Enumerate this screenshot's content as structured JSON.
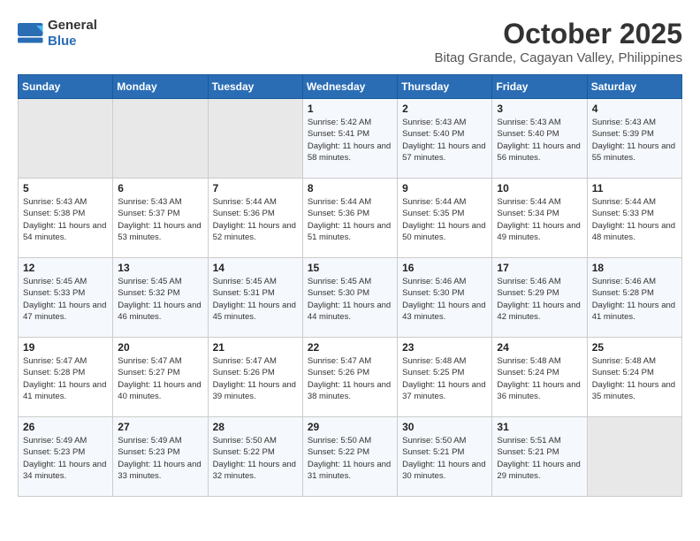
{
  "logo": {
    "general": "General",
    "blue": "Blue"
  },
  "title": "October 2025",
  "location": "Bitag Grande, Cagayan Valley, Philippines",
  "days_header": [
    "Sunday",
    "Monday",
    "Tuesday",
    "Wednesday",
    "Thursday",
    "Friday",
    "Saturday"
  ],
  "weeks": [
    [
      {
        "day": "",
        "empty": true
      },
      {
        "day": "",
        "empty": true
      },
      {
        "day": "",
        "empty": true
      },
      {
        "day": "1",
        "sunrise": "5:42 AM",
        "sunset": "5:41 PM",
        "daylight": "11 hours and 58 minutes."
      },
      {
        "day": "2",
        "sunrise": "5:43 AM",
        "sunset": "5:40 PM",
        "daylight": "11 hours and 57 minutes."
      },
      {
        "day": "3",
        "sunrise": "5:43 AM",
        "sunset": "5:40 PM",
        "daylight": "11 hours and 56 minutes."
      },
      {
        "day": "4",
        "sunrise": "5:43 AM",
        "sunset": "5:39 PM",
        "daylight": "11 hours and 55 minutes."
      }
    ],
    [
      {
        "day": "5",
        "sunrise": "5:43 AM",
        "sunset": "5:38 PM",
        "daylight": "11 hours and 54 minutes."
      },
      {
        "day": "6",
        "sunrise": "5:43 AM",
        "sunset": "5:37 PM",
        "daylight": "11 hours and 53 minutes."
      },
      {
        "day": "7",
        "sunrise": "5:44 AM",
        "sunset": "5:36 PM",
        "daylight": "11 hours and 52 minutes."
      },
      {
        "day": "8",
        "sunrise": "5:44 AM",
        "sunset": "5:36 PM",
        "daylight": "11 hours and 51 minutes."
      },
      {
        "day": "9",
        "sunrise": "5:44 AM",
        "sunset": "5:35 PM",
        "daylight": "11 hours and 50 minutes."
      },
      {
        "day": "10",
        "sunrise": "5:44 AM",
        "sunset": "5:34 PM",
        "daylight": "11 hours and 49 minutes."
      },
      {
        "day": "11",
        "sunrise": "5:44 AM",
        "sunset": "5:33 PM",
        "daylight": "11 hours and 48 minutes."
      }
    ],
    [
      {
        "day": "12",
        "sunrise": "5:45 AM",
        "sunset": "5:33 PM",
        "daylight": "11 hours and 47 minutes."
      },
      {
        "day": "13",
        "sunrise": "5:45 AM",
        "sunset": "5:32 PM",
        "daylight": "11 hours and 46 minutes."
      },
      {
        "day": "14",
        "sunrise": "5:45 AM",
        "sunset": "5:31 PM",
        "daylight": "11 hours and 45 minutes."
      },
      {
        "day": "15",
        "sunrise": "5:45 AM",
        "sunset": "5:30 PM",
        "daylight": "11 hours and 44 minutes."
      },
      {
        "day": "16",
        "sunrise": "5:46 AM",
        "sunset": "5:30 PM",
        "daylight": "11 hours and 43 minutes."
      },
      {
        "day": "17",
        "sunrise": "5:46 AM",
        "sunset": "5:29 PM",
        "daylight": "11 hours and 42 minutes."
      },
      {
        "day": "18",
        "sunrise": "5:46 AM",
        "sunset": "5:28 PM",
        "daylight": "11 hours and 41 minutes."
      }
    ],
    [
      {
        "day": "19",
        "sunrise": "5:47 AM",
        "sunset": "5:28 PM",
        "daylight": "11 hours and 41 minutes."
      },
      {
        "day": "20",
        "sunrise": "5:47 AM",
        "sunset": "5:27 PM",
        "daylight": "11 hours and 40 minutes."
      },
      {
        "day": "21",
        "sunrise": "5:47 AM",
        "sunset": "5:26 PM",
        "daylight": "11 hours and 39 minutes."
      },
      {
        "day": "22",
        "sunrise": "5:47 AM",
        "sunset": "5:26 PM",
        "daylight": "11 hours and 38 minutes."
      },
      {
        "day": "23",
        "sunrise": "5:48 AM",
        "sunset": "5:25 PM",
        "daylight": "11 hours and 37 minutes."
      },
      {
        "day": "24",
        "sunrise": "5:48 AM",
        "sunset": "5:24 PM",
        "daylight": "11 hours and 36 minutes."
      },
      {
        "day": "25",
        "sunrise": "5:48 AM",
        "sunset": "5:24 PM",
        "daylight": "11 hours and 35 minutes."
      }
    ],
    [
      {
        "day": "26",
        "sunrise": "5:49 AM",
        "sunset": "5:23 PM",
        "daylight": "11 hours and 34 minutes."
      },
      {
        "day": "27",
        "sunrise": "5:49 AM",
        "sunset": "5:23 PM",
        "daylight": "11 hours and 33 minutes."
      },
      {
        "day": "28",
        "sunrise": "5:50 AM",
        "sunset": "5:22 PM",
        "daylight": "11 hours and 32 minutes."
      },
      {
        "day": "29",
        "sunrise": "5:50 AM",
        "sunset": "5:22 PM",
        "daylight": "11 hours and 31 minutes."
      },
      {
        "day": "30",
        "sunrise": "5:50 AM",
        "sunset": "5:21 PM",
        "daylight": "11 hours and 30 minutes."
      },
      {
        "day": "31",
        "sunrise": "5:51 AM",
        "sunset": "5:21 PM",
        "daylight": "11 hours and 29 minutes."
      },
      {
        "day": "",
        "empty": true
      }
    ]
  ],
  "labels": {
    "sunrise": "Sunrise:",
    "sunset": "Sunset:",
    "daylight": "Daylight:"
  }
}
